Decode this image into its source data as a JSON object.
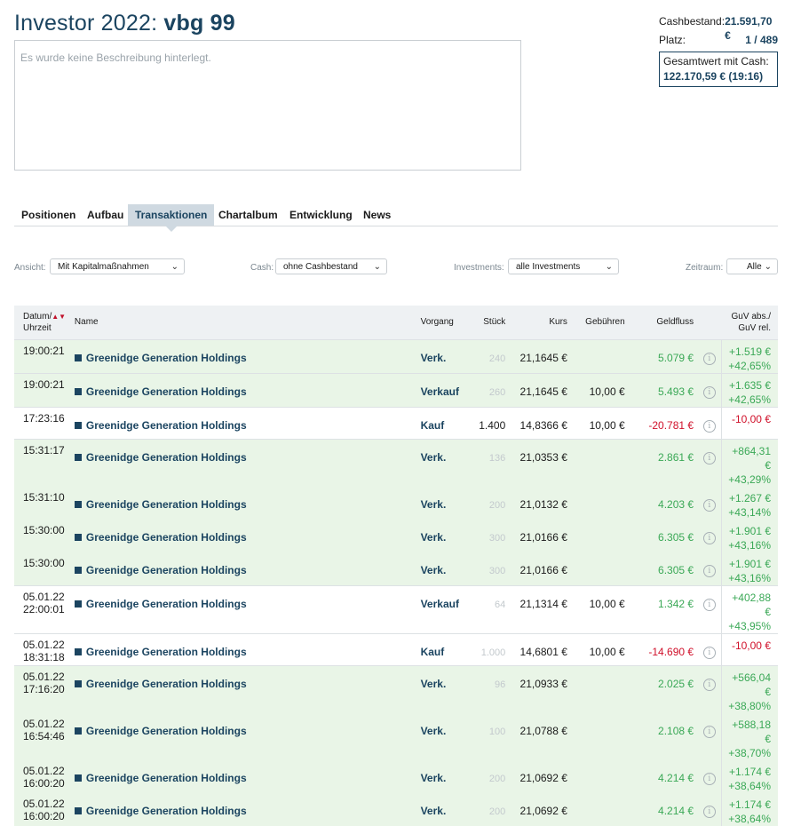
{
  "header": {
    "title_prefix": "Investor 2022:",
    "title_name": "vbg 99"
  },
  "description": "Es wurde keine Beschreibung hinterlegt.",
  "stats": {
    "cash_label": "Cashbestand:",
    "cash_value": "21.591,70 €",
    "rank_label": "Platz:",
    "rank_value": "1 / 489",
    "total_label": "Gesamtwert mit Cash:",
    "total_value": "122.170,59 € (19:16)"
  },
  "tabs": [
    "Positionen",
    "Aufbau",
    "Transaktionen",
    "Chartalbum",
    "Entwicklung",
    "News"
  ],
  "filters": {
    "ansicht_label": "Ansicht:",
    "ansicht_value": "Mit Kapitalmaßnahmen",
    "cash_label": "Cash:",
    "cash_value": "ohne Cashbestand",
    "investments_label": "Investments:",
    "investments_value": "alle Investments",
    "zeitraum_label": "Zeitraum:",
    "zeitraum_value": "Alle"
  },
  "table": {
    "headers": {
      "date1": "Datum/",
      "date2": "Uhrzeit",
      "name": "Name",
      "vorgang": "Vorgang",
      "stueck": "Stück",
      "kurs": "Kurs",
      "gebuehren": "Gebühren",
      "geldfluss": "Geldfluss",
      "guv1": "GuV abs./",
      "guv2": "GuV rel."
    },
    "rows": [
      {
        "d1": "19:00:21",
        "d2": "",
        "name": "Greenidge Generation Holdings",
        "vorgang": "Verk.",
        "stueck": "240",
        "kurs": "21,1645 €",
        "geb": "",
        "geld": "5.079 €",
        "guv1": "+1.519 €",
        "guv2": "+42,65%"
      },
      {
        "d1": "19:00:21",
        "d2": "",
        "name": "Greenidge Generation Holdings",
        "vorgang": "Verkauf",
        "stueck": "260",
        "kurs": "21,1645 €",
        "geb": "10,00 €",
        "geld": "5.493 €",
        "guv1": "+1.635 €",
        "guv2": "+42,65%"
      },
      {
        "d1": "17:23:16",
        "d2": "",
        "name": "Greenidge Generation Holdings",
        "vorgang": "Kauf",
        "stueck": "1.400",
        "kurs": "14,8366 €",
        "geb": "10,00 €",
        "geld": "-20.781 €",
        "guv1": "-10,00 €",
        "guv2": ""
      },
      {
        "d1": "15:31:17",
        "d2": "",
        "name": "Greenidge Generation Holdings",
        "vorgang": "Verk.",
        "stueck": "136",
        "kurs": "21,0353 €",
        "geb": "",
        "geld": "2.861 €",
        "guv1": "+864,31 €",
        "guv2": "+43,29%"
      },
      {
        "d1": "15:31:10",
        "d2": "",
        "name": "Greenidge Generation Holdings",
        "vorgang": "Verk.",
        "stueck": "200",
        "kurs": "21,0132 €",
        "geb": "",
        "geld": "4.203 €",
        "guv1": "+1.267 €",
        "guv2": "+43,14%"
      },
      {
        "d1": "15:30:00",
        "d2": "",
        "name": "Greenidge Generation Holdings",
        "vorgang": "Verk.",
        "stueck": "300",
        "kurs": "21,0166 €",
        "geb": "",
        "geld": "6.305 €",
        "guv1": "+1.901 €",
        "guv2": "+43,16%"
      },
      {
        "d1": "15:30:00",
        "d2": "",
        "name": "Greenidge Generation Holdings",
        "vorgang": "Verk.",
        "stueck": "300",
        "kurs": "21,0166 €",
        "geb": "",
        "geld": "6.305 €",
        "guv1": "+1.901 €",
        "guv2": "+43,16%"
      },
      {
        "d1": "05.01.22",
        "d2": "22:00:01",
        "name": "Greenidge Generation Holdings",
        "vorgang": "Verkauf",
        "stueck": "64",
        "kurs": "21,1314 €",
        "geb": "10,00 €",
        "geld": "1.342 €",
        "guv1": "+402,88 €",
        "guv2": "+43,95%"
      },
      {
        "d1": "05.01.22",
        "d2": "18:31:18",
        "name": "Greenidge Generation Holdings",
        "vorgang": "Kauf",
        "stueck": "1.000",
        "kurs": "14,6801 €",
        "geb": "10,00 €",
        "geld": "-14.690 €",
        "guv1": "-10,00 €",
        "guv2": ""
      },
      {
        "d1": "05.01.22",
        "d2": "17:16:20",
        "name": "Greenidge Generation Holdings",
        "vorgang": "Verk.",
        "stueck": "96",
        "kurs": "21,0933 €",
        "geb": "",
        "geld": "2.025 €",
        "guv1": "+566,04 €",
        "guv2": "+38,80%"
      },
      {
        "d1": "05.01.22",
        "d2": "16:54:46",
        "name": "Greenidge Generation Holdings",
        "vorgang": "Verk.",
        "stueck": "100",
        "kurs": "21,0788 €",
        "geb": "",
        "geld": "2.108 €",
        "guv1": "+588,18 €",
        "guv2": "+38,70%"
      },
      {
        "d1": "05.01.22",
        "d2": "16:00:20",
        "name": "Greenidge Generation Holdings",
        "vorgang": "Verk.",
        "stueck": "200",
        "kurs": "21,0692 €",
        "geb": "",
        "geld": "4.214 €",
        "guv1": "+1.174 €",
        "guv2": "+38,64%"
      },
      {
        "d1": "05.01.22",
        "d2": "16:00:20",
        "name": "Greenidge Generation Holdings",
        "vorgang": "Verk.",
        "stueck": "200",
        "kurs": "21,0692 €",
        "geb": "",
        "geld": "4.214 €",
        "guv1": "+1.174 €",
        "guv2": "+38,64%"
      }
    ]
  }
}
